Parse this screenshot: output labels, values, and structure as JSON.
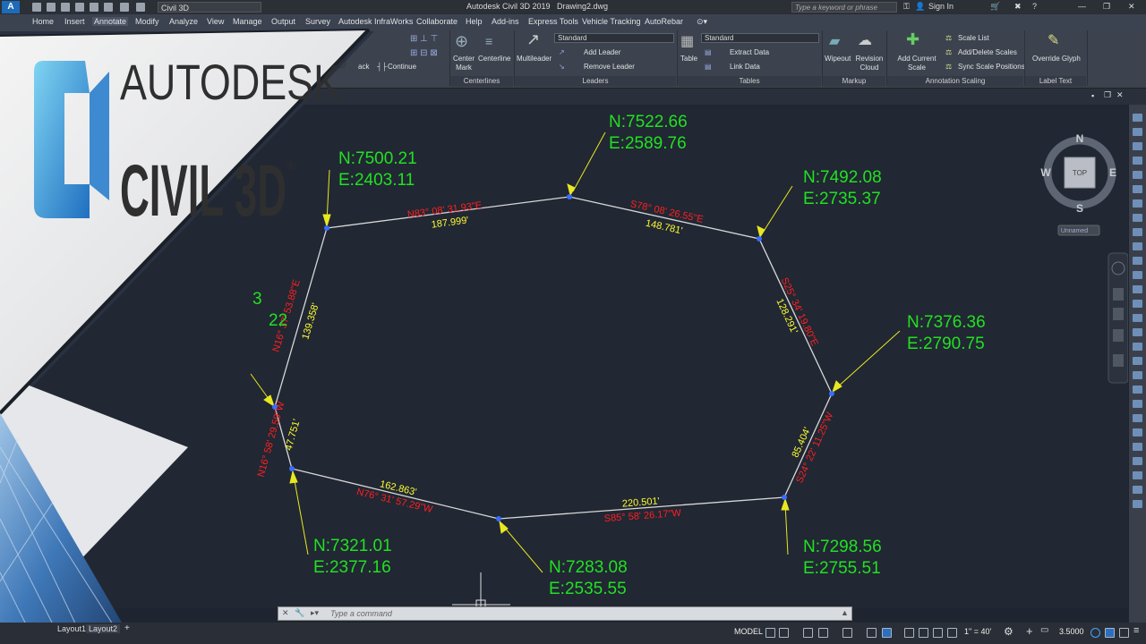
{
  "titlebar": {
    "app_badge": "A",
    "workspace": "Civil 3D",
    "title": "Autodesk Civil 3D 2019",
    "filename": "Drawing2.dwg",
    "search_placeholder": "Type a keyword or phrase",
    "sign_in": "Sign In"
  },
  "menubar": {
    "items": [
      "Home",
      "Insert",
      "Annotate",
      "Modify",
      "Analyze",
      "View",
      "Manage",
      "Output",
      "Survey",
      "Autodesk InfraWorks",
      "Collaborate",
      "Help",
      "Add-ins",
      "Express Tools",
      "Vehicle Tracking",
      "AutoRebar"
    ]
  },
  "ribbon": {
    "continue_label": "Continue",
    "ack_fragment": "ack",
    "centerlines": {
      "center_mark": "Center Mark",
      "centerline": "Centerline",
      "title": "Centerlines"
    },
    "leaders": {
      "multileader": "Multileader",
      "style": "Standard",
      "add": "Add Leader",
      "remove": "Remove Leader",
      "title": "Leaders"
    },
    "tables": {
      "table": "Table",
      "style": "Standard",
      "extract": "Extract Data",
      "link": "Link Data",
      "title": "Tables"
    },
    "markup": {
      "wipeout": "Wipeout",
      "revision_cloud": "Revision Cloud",
      "title": "Markup"
    },
    "annotation_scaling": {
      "add_current": "Add Current Scale",
      "scale_list": "Scale List",
      "add_delete": "Add/Delete Scales",
      "sync": "Sync Scale Positions",
      "title": "Annotation Scaling"
    },
    "label_text": {
      "override": "Override Glyph",
      "title": "Label Text"
    }
  },
  "logo": {
    "line1": "AUTODESK",
    "line2": "CIVIL 3D",
    "reg": "®",
    "partial_a": "3",
    "partial_b": "22"
  },
  "viewcube": {
    "n": "N",
    "s": "S",
    "e": "E",
    "w": "W",
    "top": "TOP",
    "ucs": "Unnamed"
  },
  "drawing": {
    "points": [
      {
        "n": "N:7500.21",
        "e": "E:2403.11"
      },
      {
        "n": "N:7522.66",
        "e": "E:2589.76"
      },
      {
        "n": "N:7492.08",
        "e": "E:2735.37"
      },
      {
        "n": "N:7376.36",
        "e": "E:2790.75"
      },
      {
        "n": "N:7298.56",
        "e": "E:2755.51"
      },
      {
        "n": "N:7283.08",
        "e": "E:2535.55"
      },
      {
        "n": "N:7321.01",
        "e": "E:2377.16"
      }
    ],
    "segments": [
      {
        "bearing": "N83° 08' 31.93\"E",
        "distance": "187.999'"
      },
      {
        "bearing": "S78° 08' 26.55\"E",
        "distance": "148.781'"
      },
      {
        "bearing": "S25° 34' 19.80\"E",
        "distance": "128.291'"
      },
      {
        "bearing": "S24° 22' 11.25\"W",
        "distance": "85.404'"
      },
      {
        "bearing": "S85° 58' 26.17\"W",
        "distance": "220.501'"
      },
      {
        "bearing": "N76° 31' 57.29\"W",
        "distance": "162.863'"
      },
      {
        "bearing": "N16° 58' 29.59\"W",
        "distance": "47.751'"
      },
      {
        "bearing": "N16° 37' 53.88\"E",
        "distance": "139.358'"
      }
    ],
    "colors": {
      "coord": "#22e022",
      "bearing": "#ff2020",
      "distance": "#ffff30",
      "line": "#d8d8d8",
      "leader": "#e8e820",
      "node": "#3a6cff"
    }
  },
  "command": {
    "placeholder": "Type a command"
  },
  "layouts": {
    "layout1": "Layout1",
    "layout2": "Layout2",
    "add": "+"
  },
  "status": {
    "model": "MODEL",
    "scale": "1\" = 40'",
    "value": "3.5000"
  }
}
